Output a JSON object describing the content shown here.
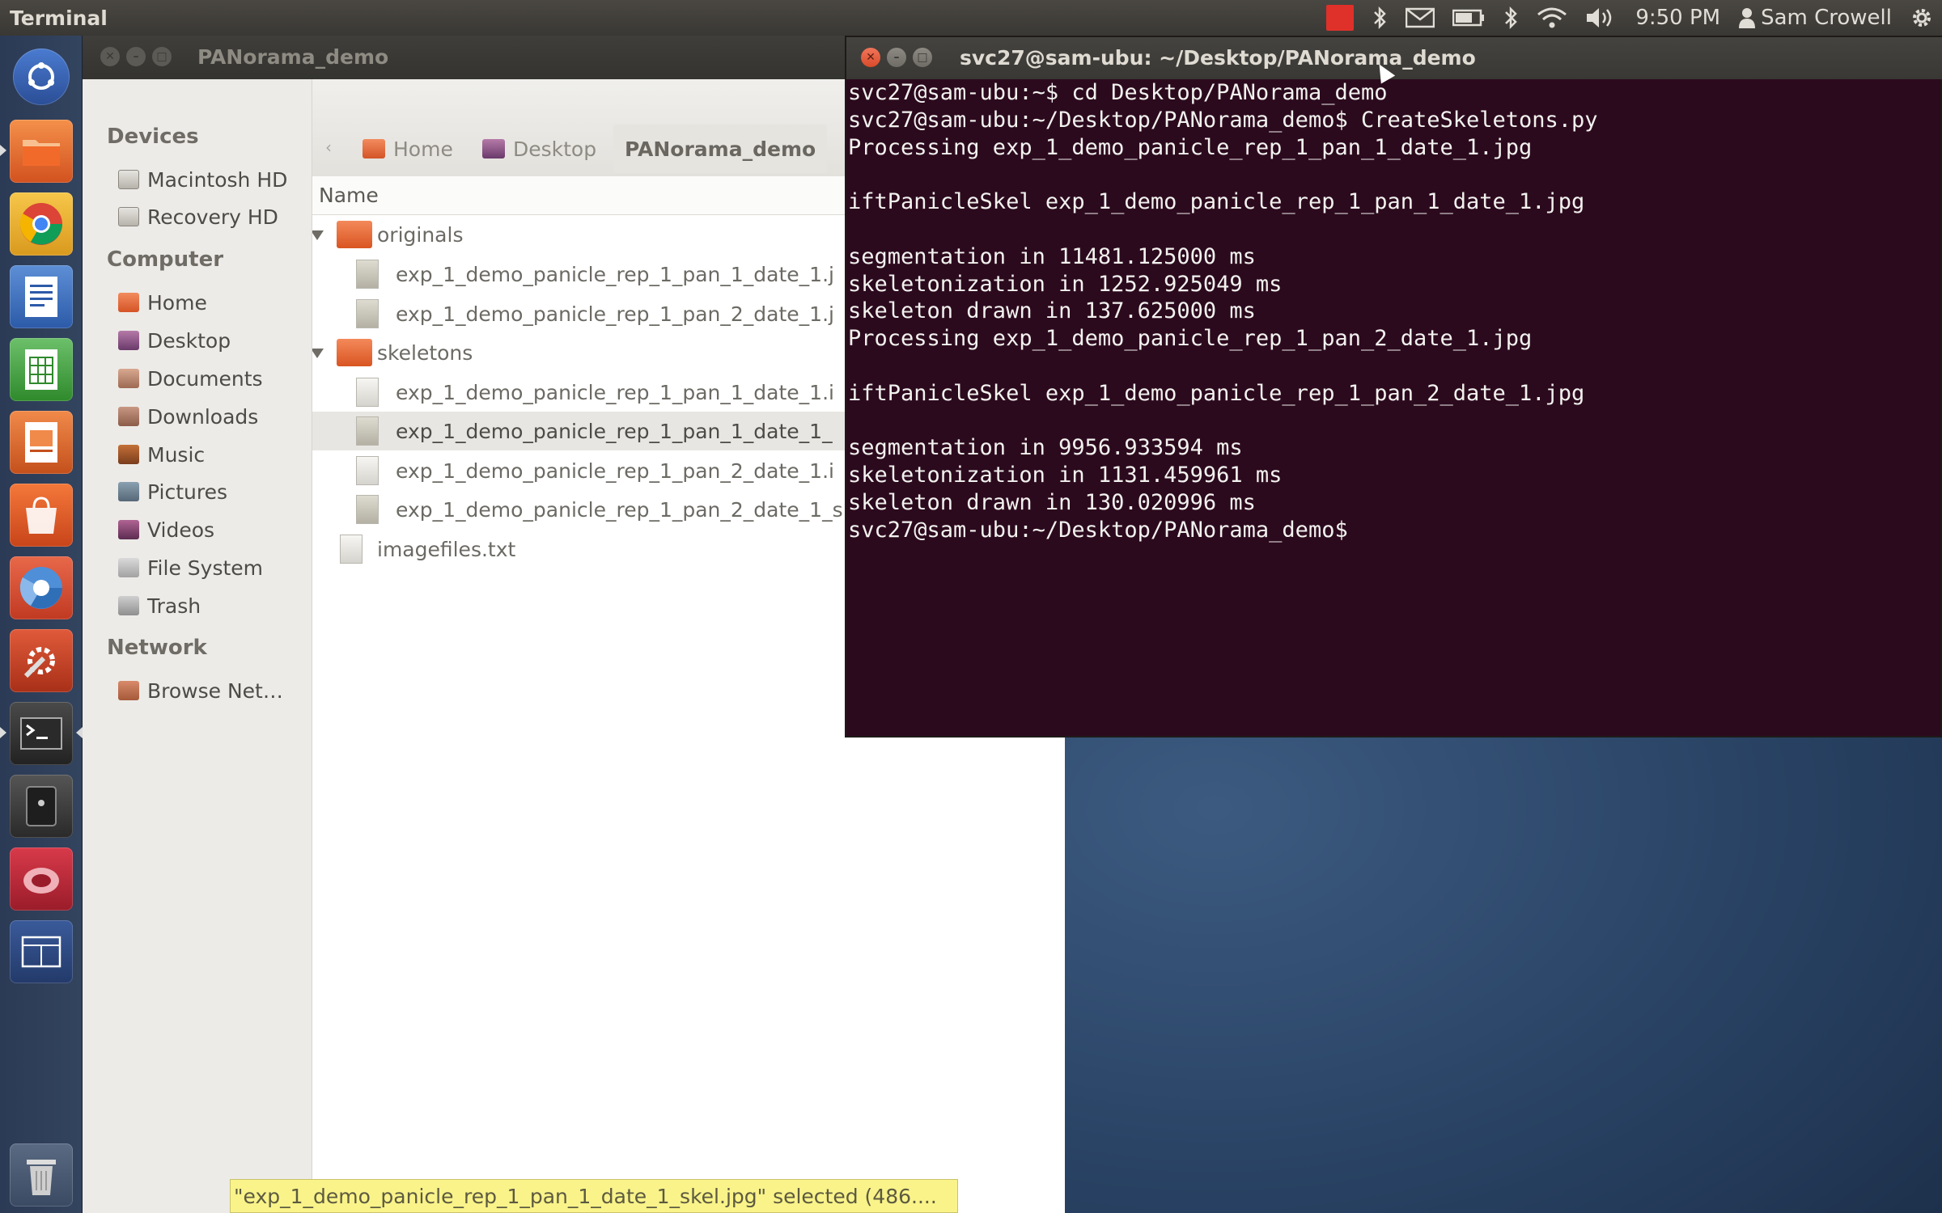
{
  "top_panel": {
    "app_title": "Terminal",
    "clock": "9:50 PM",
    "user": "Sam Crowell",
    "icons": [
      "record-icon",
      "bluetooth-icon",
      "mail-icon",
      "battery-icon",
      "bluetooth-icon",
      "wifi-icon",
      "volume-icon",
      "user-icon",
      "gear-icon"
    ]
  },
  "launcher": {
    "items": [
      "dash-home",
      "files",
      "chrome",
      "writer",
      "calc",
      "impress",
      "software-center",
      "chromium",
      "system-settings",
      "terminal",
      "disk",
      "bug-tool",
      "workspaces",
      "trash"
    ]
  },
  "file_manager": {
    "title": "PANorama_demo",
    "sidebar": {
      "devices_heading": "Devices",
      "devices": [
        "Macintosh HD",
        "Recovery HD"
      ],
      "computer_heading": "Computer",
      "computer": [
        "Home",
        "Desktop",
        "Documents",
        "Downloads",
        "Music",
        "Pictures",
        "Videos",
        "File System",
        "Trash"
      ],
      "network_heading": "Network",
      "network": [
        "Browse Net…"
      ]
    },
    "breadcrumbs": [
      "Home",
      "Desktop",
      "PANorama_demo"
    ],
    "column_header": "Name",
    "rows": [
      {
        "name": "originals",
        "kind": "folder"
      },
      {
        "name": "exp_1_demo_panicle_rep_1_pan_1_date_1.j",
        "kind": "image"
      },
      {
        "name": "exp_1_demo_panicle_rep_1_pan_2_date_1.j",
        "kind": "image"
      },
      {
        "name": "skeletons",
        "kind": "folder"
      },
      {
        "name": "exp_1_demo_panicle_rep_1_pan_1_date_1.i",
        "kind": "text"
      },
      {
        "name": "exp_1_demo_panicle_rep_1_pan_1_date_1_",
        "kind": "image"
      },
      {
        "name": "exp_1_demo_panicle_rep_1_pan_2_date_1.i",
        "kind": "text"
      },
      {
        "name": "exp_1_demo_panicle_rep_1_pan_2_date_1_s",
        "kind": "image"
      },
      {
        "name": "imagefiles.txt",
        "kind": "text"
      }
    ],
    "status": "\"exp_1_demo_panicle_rep_1_pan_1_date_1_skel.jpg\" selected (486...."
  },
  "terminal": {
    "title": "svc27@sam-ubu: ~/Desktop/PANorama_demo",
    "lines": [
      "svc27@sam-ubu:~$ cd Desktop/PANorama_demo",
      "svc27@sam-ubu:~/Desktop/PANorama_demo$ CreateSkeletons.py",
      "Processing exp_1_demo_panicle_rep_1_pan_1_date_1.jpg",
      "",
      "iftPanicleSkel exp_1_demo_panicle_rep_1_pan_1_date_1.jpg",
      "",
      "segmentation in 11481.125000 ms",
      "skeletonization in 1252.925049 ms",
      "skeleton drawn in 137.625000 ms",
      "Processing exp_1_demo_panicle_rep_1_pan_2_date_1.jpg",
      "",
      "iftPanicleSkel exp_1_demo_panicle_rep_1_pan_2_date_1.jpg",
      "",
      "segmentation in 9956.933594 ms",
      "skeletonization in 1131.459961 ms",
      "skeleton drawn in 130.020996 ms",
      "svc27@sam-ubu:~/Desktop/PANorama_demo$ "
    ]
  },
  "colors": {
    "terminal_bg": "#2c0a1e",
    "panel_bg": "#3a3834",
    "status_bg": "#f9f38a",
    "close_button": "#e05a38"
  }
}
